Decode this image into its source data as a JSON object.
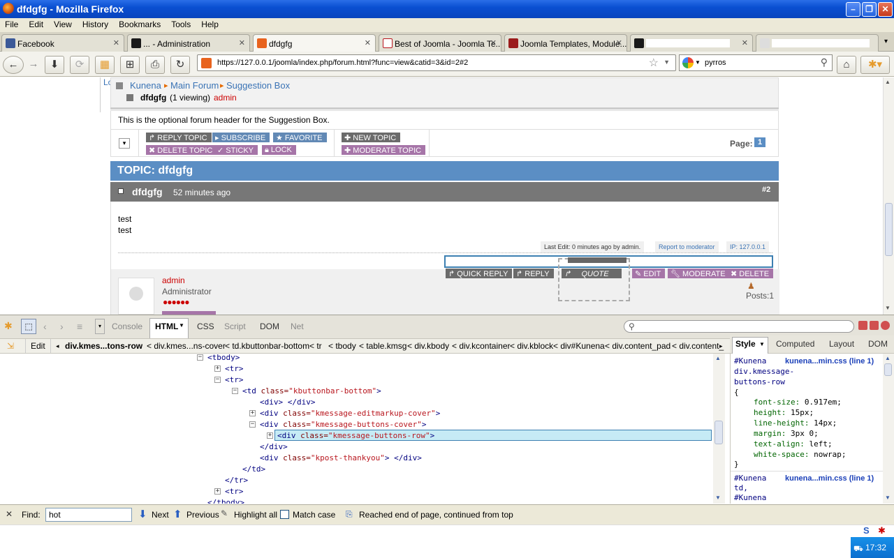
{
  "window": {
    "title": "dfdgfg - Mozilla Firefox"
  },
  "menu": [
    "File",
    "Edit",
    "View",
    "History",
    "Bookmarks",
    "Tools",
    "Help"
  ],
  "tabs": [
    {
      "label": "Facebook",
      "color": "#3b5998"
    },
    {
      "label": "... - Administration",
      "color": "#1a1a1a"
    },
    {
      "label": "dfdgfg",
      "color": "#e8631e"
    },
    {
      "label": "Best of Joomla - Joomla Te...",
      "color": "#b8151d"
    },
    {
      "label": "Joomla Templates, Module...",
      "color": "#9b1c1c"
    },
    {
      "label": "",
      "color": "#1a1a1a"
    },
    {
      "label": "",
      "color": "#dddddd"
    }
  ],
  "nav": {
    "url": "https://127.0.0.1/joomla/index.php/forum.html?func=view&catid=3&id=2#2",
    "search_value": "pyrros"
  },
  "forum": {
    "left_snippet": "Lo",
    "breadcrumb": [
      "Kunena",
      "Main Forum",
      "Suggestion Box"
    ],
    "topic_name": "dfdgfg",
    "viewing": "(1 viewing)",
    "viewer": "admin",
    "header_text": "This is the optional forum header for the Suggestion Box.",
    "top_buttons": {
      "reply_topic": "REPLY TOPIC",
      "subscribe": "SUBSCRIBE",
      "favorite": "FAVORITE",
      "delete_topic": "DELETE TOPIC",
      "sticky": "STICKY",
      "lock": "LOCK",
      "new_topic": "NEW TOPIC",
      "moderate_topic": "MODERATE TOPIC"
    },
    "page_label": "Page:",
    "page_number": "1",
    "topic_title": "TOPIC: dfdgfg",
    "post": {
      "author": "dfdgfg",
      "time": "52 minutes ago",
      "number": "#2",
      "body_lines": [
        "test",
        "test"
      ],
      "last_edit": "Last Edit: 0 minutes ago by admin.",
      "report": "Report to moderator",
      "ip": "IP: 127.0.0.1"
    },
    "post_buttons": {
      "quick_reply": "QUICK REPLY",
      "reply": "REPLY",
      "quote": "QUOTE",
      "edit": "EDIT",
      "moderate": "MODERATE",
      "delete": "DELETE"
    },
    "user": {
      "name": "admin",
      "role": "Administrator",
      "posts": "Posts:1"
    }
  },
  "firebug": {
    "tabs": [
      "Console",
      "HTML",
      "CSS",
      "Script",
      "DOM",
      "Net"
    ],
    "active_tab": "HTML",
    "edit_label": "Edit",
    "crumbs": [
      "div.kmes...tons-row",
      "< div.kmes...ns-cover",
      "< td.kbuttonbar-bottom",
      "< tr",
      "< tbody",
      "< table.kmsg",
      "< div.kbody",
      "< div.kcontainer",
      "< div.kblock",
      "< div#Kunena",
      "< div.content_pad",
      "< div.content_"
    ],
    "tree": {
      "tbody_open": "<tbody>",
      "tr1": "<tr>",
      "tr2": "<tr>",
      "td_tag": "<td",
      "td_attr": "class=",
      "td_val": "\"kbuttonbar-bottom\"",
      "div_empty": "<div> </div>",
      "div2_attr_val": "\"kmessage-editmarkup-cover\"",
      "div3_attr_val": "\"kmessage-buttons-cover\"",
      "div4_attr_val": "\"kmessage-buttons-row\"",
      "div_close": "</div>",
      "div5_attr_val": "\"kpost-thankyou\"",
      "td_close": "</td>",
      "tr_close": "</tr>",
      "tr3": "<tr>",
      "tbody_close": "</tbody>"
    },
    "side_tabs": [
      "Style",
      "Computed",
      "Layout",
      "DOM"
    ],
    "css_rule1": {
      "selector": [
        "#Kunena",
        "div.kmessage-",
        "buttons-row",
        "{"
      ],
      "source": "kunena...min.css (line 1)",
      "props": [
        {
          "name": "font-size:",
          "value": "0.917em;"
        },
        {
          "name": "height:",
          "value": "15px;"
        },
        {
          "name": "line-height:",
          "value": "14px;"
        },
        {
          "name": "margin:",
          "value": "3px 0;"
        },
        {
          "name": "text-align:",
          "value": "left;"
        },
        {
          "name": "white-space:",
          "value": "nowrap;"
        }
      ],
      "close": "}"
    },
    "css_rule2": {
      "selector": [
        "#Kunena",
        "td,",
        "#Kunena"
      ],
      "source": "kunena...min.css (line 1)"
    }
  },
  "findbar": {
    "label": "Find:",
    "value": "hot",
    "next": "Next",
    "previous": "Previous",
    "highlight": "Highlight all",
    "match_case": "Match case",
    "status": "Reached end of page, continued from top"
  },
  "taskbar": {
    "time": "17:32"
  }
}
